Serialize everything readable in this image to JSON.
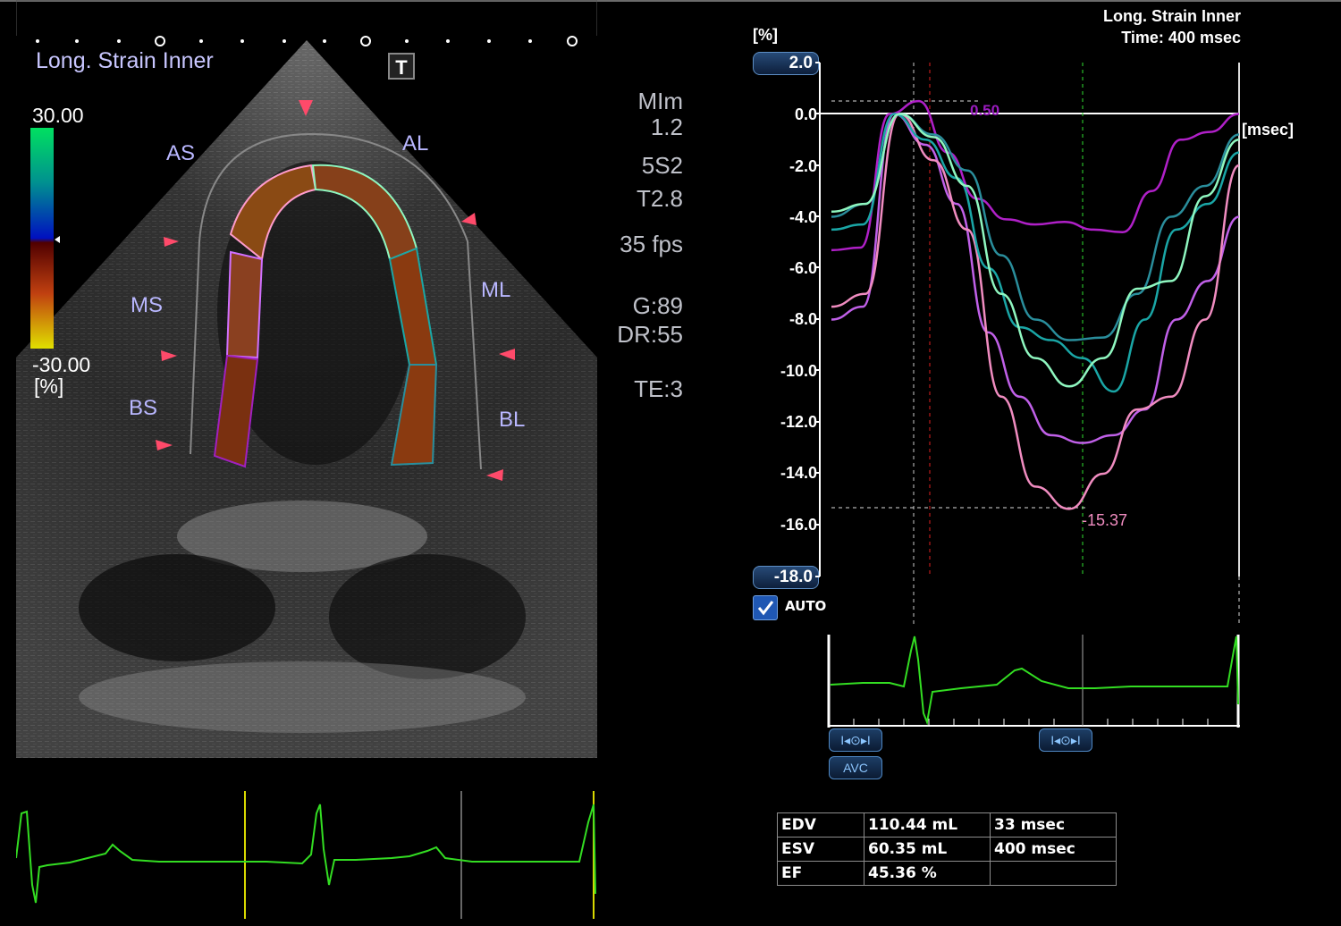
{
  "echo": {
    "mode_label": "Long. Strain Inner",
    "t_marker": "T",
    "scale_max": "30.00",
    "scale_min": "-30.00",
    "scale_unit": "[%]",
    "segments": [
      "AS",
      "AL",
      "MS",
      "ML",
      "BS",
      "BL"
    ]
  },
  "params": {
    "mi": "MIm",
    "mi_val": "1.2",
    "probe": "5S2",
    "t": "T2.8",
    "fps": "35 fps",
    "gain": "G:89",
    "dr": "DR:55",
    "te": "TE:3"
  },
  "chart": {
    "title_line1": "Long. Strain Inner",
    "title_line2": "Time: 400 msec",
    "y_unit": "[%]",
    "x_unit": "[msec]",
    "y_max_button": "2.0",
    "y_min_button": "-18.0",
    "auto_label": "AUTO",
    "peak_label": "0.50",
    "min_label": "-15.37"
  },
  "chart_data": {
    "type": "line",
    "title": "Long. Strain Inner",
    "ylabel": "[%]",
    "xlabel": "[msec]",
    "ylim": [
      -18.0,
      2.0
    ],
    "yticks": [
      "2.0",
      "0.0",
      "-2.0",
      "-4.0",
      "-6.0",
      "-8.0",
      "-10.0",
      "-12.0",
      "-14.0",
      "-16.0",
      "-18.0"
    ],
    "grid": false,
    "series": [
      {
        "color": "#b020c8",
        "values": [
          -5.3,
          -5.2,
          0.0,
          0.5,
          -1.5,
          -3.3,
          -4.1,
          -4.3,
          -4.2,
          -4.5,
          -4.6,
          -3.0,
          -1.0,
          -0.7,
          0.0
        ]
      },
      {
        "color": "#c060e8",
        "values": [
          -8.0,
          -7.5,
          0.0,
          -1.2,
          -3.5,
          -8.5,
          -11.0,
          -12.5,
          -12.8,
          -12.5,
          -11.5,
          -8.0,
          -6.5,
          -4.0
        ]
      },
      {
        "color": "#f08cc0",
        "values": [
          -7.5,
          -7.0,
          0.0,
          -1.8,
          -4.5,
          -11.0,
          -14.5,
          -15.37,
          -14.0,
          -11.5,
          -11.0,
          -8.0,
          -2.0
        ]
      },
      {
        "color": "#1aa6a6",
        "values": [
          -4.5,
          -4.3,
          0.0,
          -1.0,
          -2.5,
          -6.0,
          -8.3,
          -8.8,
          -9.5,
          -10.8,
          -8.0,
          -4.5,
          -3.5,
          -1.5
        ]
      },
      {
        "color": "#2a8e9c",
        "values": [
          -4.0,
          -3.5,
          0.0,
          -0.8,
          -2.2,
          -5.5,
          -8.0,
          -8.8,
          -8.7,
          -7.0,
          -4.0,
          -2.8,
          -0.8
        ]
      },
      {
        "color": "#8ff7c0",
        "values": [
          -3.8,
          -3.5,
          0.0,
          -0.9,
          -2.8,
          -7.0,
          -9.5,
          -10.6,
          -9.5,
          -6.8,
          -6.5,
          -3.2,
          -1.0
        ]
      }
    ]
  },
  "buttons": {
    "nav1": "I◂⊙▸I",
    "nav2": "I◂⊙▸I",
    "avc": "AVC"
  },
  "stats": {
    "rows": [
      {
        "label": "EDV",
        "value": "110.44 mL",
        "time": "33 msec"
      },
      {
        "label": "ESV",
        "value": "60.35 mL",
        "time": "400 msec"
      },
      {
        "label": "EF",
        "value": "45.36 %",
        "time": ""
      }
    ]
  },
  "colors": {
    "ecg": "#33dd22",
    "segment_fill": "#8a3a10",
    "marker": "#ff4a6a",
    "label": "#b9b7ff"
  }
}
